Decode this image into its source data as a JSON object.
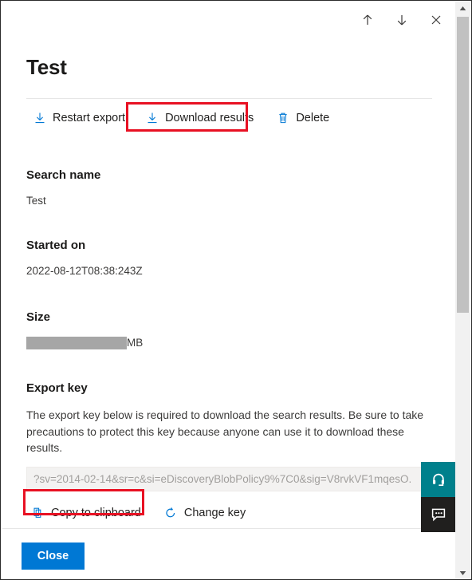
{
  "window": {
    "topbar": [
      {
        "name": "previous-item",
        "icon": "arrow-up-icon"
      },
      {
        "name": "next-item",
        "icon": "arrow-down-icon"
      },
      {
        "name": "close-panel",
        "icon": "close-icon"
      }
    ]
  },
  "header": {
    "title": "Test"
  },
  "commandbar": {
    "items": [
      {
        "label": "Restart export",
        "icon": "download-icon",
        "highlighted": false
      },
      {
        "label": "Download results",
        "icon": "download-icon",
        "highlighted": true
      },
      {
        "label": "Delete",
        "icon": "trash-icon",
        "highlighted": false
      }
    ]
  },
  "fields": {
    "search_name": {
      "label": "Search name",
      "value": "Test"
    },
    "started_on": {
      "label": "Started on",
      "value": "2022-08-12T08:38:243Z"
    },
    "size": {
      "label": "Size",
      "value_redacted": true,
      "unit": "MB"
    },
    "export_key": {
      "label": "Export key",
      "description": "The export key below is required to download the search results. Be sure to take precautions to protect this key because anyone can use it to download these results.",
      "value": "?sv=2014-02-14&sr=c&si=eDiscoveryBlobPolicy9%7C0&sig=V8rvkVF1mqesO.",
      "placeholder": "",
      "actions": [
        {
          "label": "Copy to clipboard",
          "icon": "copy-icon",
          "highlighted": true
        },
        {
          "label": "Change key",
          "icon": "refresh-icon",
          "highlighted": false
        }
      ]
    }
  },
  "footer": {
    "close_label": "Close"
  },
  "widgets": [
    {
      "name": "support-widget",
      "icon": "headset-icon",
      "color": "#00808c"
    },
    {
      "name": "feedback-widget",
      "icon": "chat-bubble-icon",
      "color": "#201f1e"
    }
  ],
  "colors": {
    "accent": "#0078d4",
    "highlight": "#e81123",
    "teal": "#00808c",
    "dark": "#201f1e",
    "redaction": "#a6a6a6"
  }
}
